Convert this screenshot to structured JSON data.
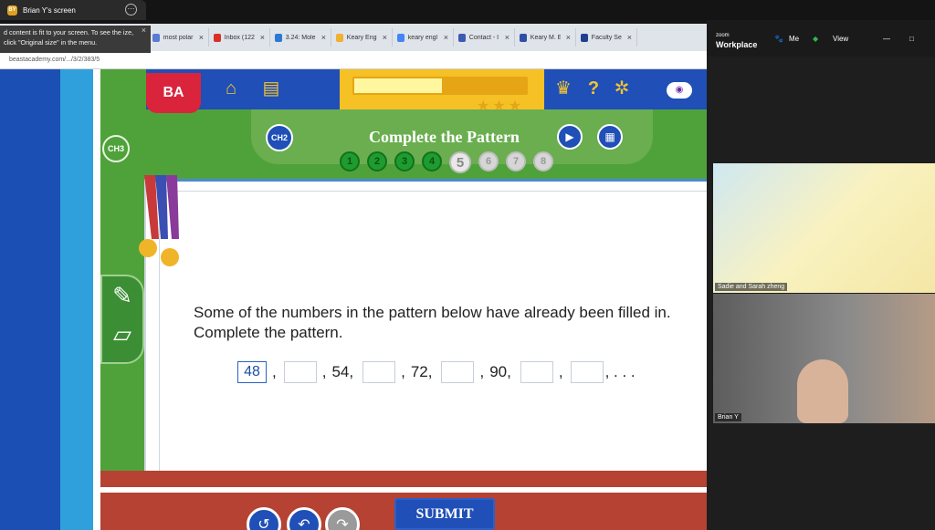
{
  "share": {
    "avatar_initials": "BY",
    "title": "Brian Y's screen",
    "more_icon": "ellipsis-icon",
    "notice": "d content is fit to your screen. To see the ize, click \"Original size\" in the menu.",
    "notice_close": "×"
  },
  "browser": {
    "tabs": [
      {
        "label": "most polar",
        "color": "#5a7bd4"
      },
      {
        "label": "Inbox (122",
        "color": "#d93025"
      },
      {
        "label": "3.24: Mole",
        "color": "#2a7ad4"
      },
      {
        "label": "Keary Engl",
        "color": "#f0b030"
      },
      {
        "label": "keary engl",
        "color": "#4285f4"
      },
      {
        "label": "Contact - I",
        "color": "#3b5bb3"
      },
      {
        "label": "Keary M. E",
        "color": "#2e4fa8"
      },
      {
        "label": "Faculty Sea",
        "color": "#1f3f8f"
      }
    ],
    "close_char": "×",
    "url": "beastacademy.com/.../3/2/383/5"
  },
  "app": {
    "logo": "BA",
    "chapter_left": "CH3",
    "chapter_current": "CH2",
    "title": "Complete the Pattern",
    "progress_fraction": 0.5,
    "stars": "★★★",
    "help": "?",
    "gear": "✲",
    "dots": [
      {
        "label": "1",
        "state": "done"
      },
      {
        "label": "2",
        "state": "done"
      },
      {
        "label": "3",
        "state": "done"
      },
      {
        "label": "4",
        "state": "done"
      },
      {
        "label": "5",
        "state": "current"
      },
      {
        "label": "6",
        "state": "todo"
      },
      {
        "label": "7",
        "state": "todo"
      },
      {
        "label": "8",
        "state": "todo"
      }
    ],
    "question": "Some of the numbers in the pattern below have already been filled in. Complete the pattern.",
    "pattern": {
      "first_answer": "48",
      "given": [
        "54,",
        "72,",
        "90,"
      ],
      "ellipsis": ", . . ."
    },
    "submit": "SUBMIT"
  },
  "zoom": {
    "brand_small": "zoom",
    "brand": "Workplace",
    "me_label": "Me",
    "view_label": "View",
    "participants": [
      {
        "name": "Sadie and Sarah zheng"
      },
      {
        "name": "Brian Y"
      }
    ]
  }
}
